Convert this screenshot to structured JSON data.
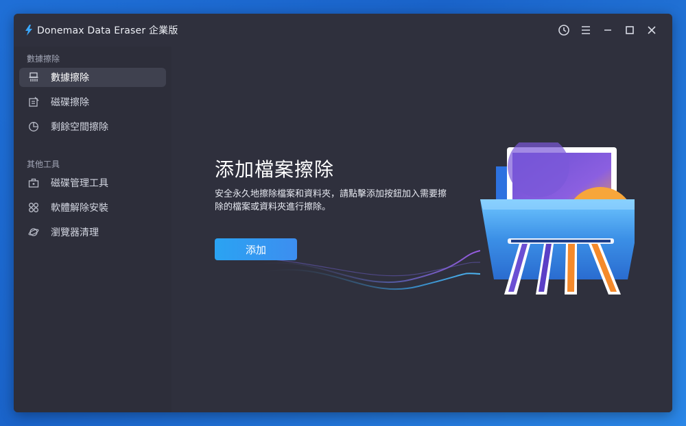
{
  "window": {
    "title": "Donemax Data Eraser 企業版",
    "icons": [
      "history-icon",
      "menu-icon",
      "minimize-icon",
      "maximize-icon",
      "close-icon"
    ]
  },
  "sidebar": {
    "section1_label": "數據擦除",
    "items1": [
      {
        "label": "數據擦除",
        "icon": "shredder-icon",
        "active": true
      },
      {
        "label": "磁碟擦除",
        "icon": "disk-edit-icon",
        "active": false
      },
      {
        "label": "剩餘空間擦除",
        "icon": "pie-chart-icon",
        "active": false
      }
    ],
    "section2_label": "其他工具",
    "items2": [
      {
        "label": "磁碟管理工具",
        "icon": "toolbox-icon",
        "active": false
      },
      {
        "label": "軟體解除安裝",
        "icon": "apps-icon",
        "active": false
      },
      {
        "label": "瀏覽器清理",
        "icon": "planet-icon",
        "active": false
      }
    ]
  },
  "main": {
    "heading": "添加檔案擦除",
    "description": "安全永久地擦除檔案和資料夾，請點擊添加按鈕加入需要擦除的檔案或資料夾進行擦除。",
    "add_button": "添加"
  },
  "colors": {
    "accent": "#2aa3f2",
    "window_bg": "#2f303d",
    "sidebar_bg": "#2d2e3a",
    "active_item": "#3f414f"
  }
}
